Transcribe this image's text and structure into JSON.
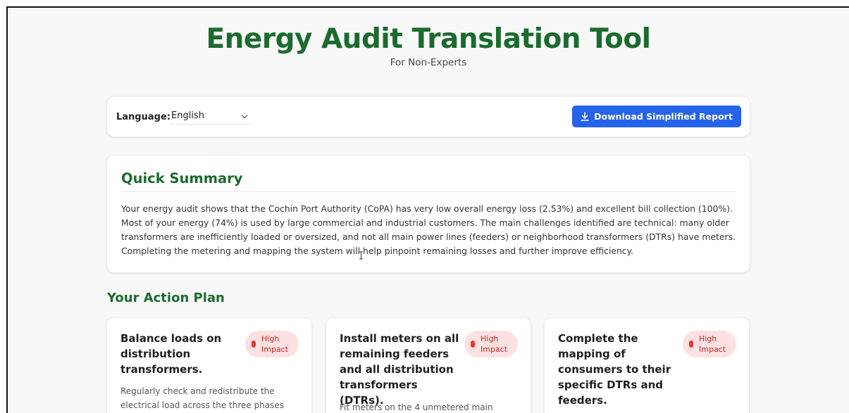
{
  "header": {
    "title": "Energy Audit Translation Tool",
    "subtitle": "For Non-Experts"
  },
  "toolbar": {
    "language_label": "Language:",
    "language_selected": "English",
    "download_label": "Download Simplified Report",
    "download_icon": "download-icon"
  },
  "summary": {
    "heading": "Quick Summary",
    "text": "Your energy audit shows that the Cochin Port Authority (CoPA) has very low overall energy loss (2.53%) and excellent bill collection (100%). Most of your energy (74%) is used by large commercial and industrial customers. The main challenges identified are technical: many older transformers are inefficiently loaded or oversized, and not all main power lines (feeders) or neighborhood transformers (DTRs) have meters. Completing the metering and mapping the system will help pinpoint remaining losses and further improve efficiency."
  },
  "action_plan": {
    "heading": "Your Action Plan",
    "items": [
      {
        "title": "Balance loads on distribution transformers.",
        "badge": "High Impact",
        "description": "Regularly check and redistribute the electrical load across the three phases"
      },
      {
        "title": "Install meters on all remaining feeders and all distribution transformers (DTRs).",
        "badge": "High Impact",
        "description": "Fit meters on the 4 unmetered main"
      },
      {
        "title": "Complete the mapping of consumers to their specific DTRs and feeders.",
        "badge": "High Impact",
        "description": ""
      }
    ]
  },
  "colors": {
    "brand_green": "#1b6b2e",
    "button_blue": "#2563eb",
    "badge_bg": "#fde1e1",
    "badge_text": "#c62828"
  }
}
